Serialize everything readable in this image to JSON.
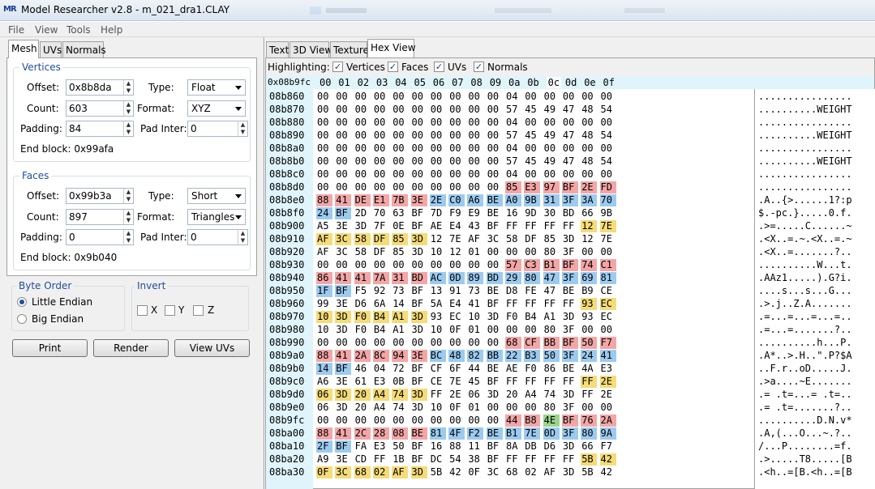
{
  "window": {
    "title": "Model Researcher v2.8 - m_021_dra1.CLAY",
    "logo": "MR"
  },
  "menu": [
    "File",
    "View",
    "Tools",
    "Help"
  ],
  "left_tabs": [
    "Mesh",
    "UVs",
    "Normals"
  ],
  "vertices": {
    "title": "Vertices",
    "offset_label": "Offset:",
    "offset": "0x8b8da",
    "type_label": "Type:",
    "type": "Float",
    "count_label": "Count:",
    "count": "603",
    "format_label": "Format:",
    "format": "XYZ",
    "padding_label": "Padding:",
    "padding": "84",
    "padinter_label": "Pad Inter:",
    "padinter": "0",
    "endblock": "End block: 0x99afa"
  },
  "faces": {
    "title": "Faces",
    "offset_label": "Offset:",
    "offset": "0x99b3a",
    "type_label": "Type:",
    "type": "Short",
    "count_label": "Count:",
    "count": "897",
    "format_label": "Format:",
    "format": "Triangles",
    "padding_label": "Padding:",
    "padding": "0",
    "padinter_label": "Pad Inter:",
    "padinter": "0",
    "endblock": "End block: 0x9b040"
  },
  "byteorder": {
    "title": "Byte Order",
    "little": "Little Endian",
    "big": "Big Endian",
    "selected": "little"
  },
  "invert": {
    "title": "Invert",
    "x": "X",
    "y": "Y",
    "z": "Z"
  },
  "buttons": {
    "print": "Print",
    "render": "Render",
    "viewuvs": "View UVs"
  },
  "right_tabs": [
    "Text",
    "3D View",
    "Texture",
    "Hex View"
  ],
  "highlighting": {
    "label": "Highlighting:",
    "vertices": "Vertices",
    "faces": "Faces",
    "uvs": "UVs",
    "normals": "Normals"
  },
  "hex": {
    "cursor_addr": "0x08b9fc",
    "col_headers": [
      "00",
      "01",
      "02",
      "03",
      "04",
      "05",
      "06",
      "07",
      "08",
      "09",
      "0a",
      "0b",
      "0c",
      "0d",
      "0e",
      "0f"
    ],
    "rows": [
      {
        "a": "08b860",
        "b": "00 00 00 00 00 00 00 00 00 00 04 00 00 00 00 00",
        "h": "",
        "t": "................"
      },
      {
        "a": "08b870",
        "b": "00 00 00 00 00 00 00 00 00 00 57 45 49 47 48 54",
        "h": "",
        "t": "..........WEIGHT"
      },
      {
        "a": "08b880",
        "b": "00 00 00 00 00 00 00 00 00 00 04 00 00 00 00 00",
        "h": "",
        "t": "................"
      },
      {
        "a": "08b890",
        "b": "00 00 00 00 00 00 00 00 00 00 57 45 49 47 48 54",
        "h": "",
        "t": "..........WEIGHT"
      },
      {
        "a": "08b8a0",
        "b": "00 00 00 00 00 00 00 00 00 00 04 00 00 00 00 00",
        "h": "",
        "t": "................"
      },
      {
        "a": "08b8b0",
        "b": "00 00 00 00 00 00 00 00 00 00 57 45 49 47 48 54",
        "h": "",
        "t": "..........WEIGHT"
      },
      {
        "a": "08b8c0",
        "b": "00 00 00 00 00 00 00 00 00 00 04 00 00 00 00 00",
        "h": "",
        "t": "................"
      },
      {
        "a": "08b8d0",
        "b": "00 00 00 00 00 00 00 00 00 00 85 E3 97 BF 2E FD",
        "h": "..........vvvvvv",
        "t": "................"
      },
      {
        "a": "08b8e0",
        "b": "88 41 DE E1 7B 3E 2E C0 A6 BE A0 9B 31 3F 3A 70",
        "h": "vvvvvvffffffffff",
        "t": ".A..{>......1?:p"
      },
      {
        "a": "08b8f0",
        "b": "24 BF 2D 70 63 BF 7D F9 E9 BE 16 9D 30 BD 66 9B",
        "h": "ff..............",
        "t": "$.-pc.}.....0.f."
      },
      {
        "a": "08b900",
        "b": "A5 3E 3D 7F 0E BF AE E4 43 BF FF FF FF FF 12 7E",
        "h": "..............uu",
        "t": ".>=.....C......~"
      },
      {
        "a": "08b910",
        "b": "AF 3C 58 DF 85 3D 12 7E AF 3C 58 DF 85 3D 12 7E",
        "h": "uuuuuu..........",
        "t": ".<X..=.~.<X..=.~"
      },
      {
        "a": "08b920",
        "b": "AF 3C 58 DF 85 3D 10 12 01 00 00 00 80 3F 00 00",
        "h": "",
        "t": ".<X..=.......?.."
      },
      {
        "a": "08b930",
        "b": "00 00 00 00 00 00 00 00 00 00 57 C3 B1 BF 74 C1",
        "h": "..........vvvvvv",
        "t": "..........W...t."
      },
      {
        "a": "08b940",
        "b": "86 41 41 7A 31 BD AC 0D 89 BD 29 80 47 3F 69 81",
        "h": "vvvvvvffffffffff",
        "t": ".AAz1.....).G?i."
      },
      {
        "a": "08b950",
        "b": "1F BF F5 92 73 BF 13 91 73 BE D8 FE 47 BE B9 CE",
        "h": "ff..............",
        "t": "....s...s...G..."
      },
      {
        "a": "08b960",
        "b": "99 3E D6 6A 14 BF 5A E4 41 BF FF FF FF FF 93 EC",
        "h": "..............uu",
        "t": ".>.j..Z.A......."
      },
      {
        "a": "08b970",
        "b": "10 3D F0 B4 A1 3D 93 EC 10 3D F0 B4 A1 3D 93 EC",
        "h": "uuuuuu..........",
        "t": ".=...=...=...=.."
      },
      {
        "a": "08b980",
        "b": "10 3D F0 B4 A1 3D 10 0F 01 00 00 00 80 3F 00 00",
        "h": "",
        "t": ".=...=.......?.."
      },
      {
        "a": "08b990",
        "b": "00 00 00 00 00 00 00 00 00 00 68 CF BB BF 50 F7",
        "h": "..........vvvvvv",
        "t": "..........h...P."
      },
      {
        "a": "08b9a0",
        "b": "88 41 2A 8C 94 3E BC 48 82 BB 22 B3 50 3F 24 41",
        "h": "vvvvvvffffffffff",
        "t": ".A*..>.H..\".P?$A"
      },
      {
        "a": "08b9b0",
        "b": "14 BF 46 04 72 BF CF 6F 44 BE AE F0 86 BE 4A E3",
        "h": "ff..............",
        "t": "..F.r..oD.....J."
      },
      {
        "a": "08b9c0",
        "b": "A6 3E 61 E3 0B BF CE 7E 45 BF FF FF FF FF FF 2E",
        "h": "..............uu",
        "t": ".>a....~E......."
      },
      {
        "a": "08b9d0",
        "b": "06 3D 20 A4 74 3D FF 2E 06 3D 20 A4 74 3D FF 2E",
        "h": "uuuuuu..........",
        "t": ".= .t=...= .t=.."
      },
      {
        "a": "08b9e0",
        "b": "06 3D 20 A4 74 3D 10 0F 01 00 00 00 80 3F 00 00",
        "h": "",
        "t": ".= .t=.......?.."
      },
      {
        "a": "08b9fc",
        "b": "00 00 00 00 00 00 00 00 00 00 44 B8 4E BF 76 2A",
        "h": "..........vvnvvv",
        "t": "..........D.N.v*"
      },
      {
        "a": "08ba00",
        "b": "88 41 2C 28 08 BE 81 4F F2 BE B1 7E 0D 3F 80 9A",
        "h": "vvvvvvffffffffff",
        "t": ".A,(...O...~.?.."
      },
      {
        "a": "08ba10",
        "b": "2F BF FA E3 50 BF 16 88 11 BF 8A DB D6 3D 66 F7",
        "h": "ff..............",
        "t": "/...P........=f."
      },
      {
        "a": "08ba20",
        "b": "A9 3E CD FF 1B BF DC 54 38 BF FF FF FF FF 5B 42",
        "h": "..............uu",
        "t": ".>.....T8.....[B"
      },
      {
        "a": "08ba30",
        "b": "0F 3C 68 02 AF 3D 5B 42 0F 3C 68 02 AF 3D 5B 42",
        "h": "uuuuuu..........",
        "t": ".<h..=[B.<h..=[B"
      }
    ]
  }
}
